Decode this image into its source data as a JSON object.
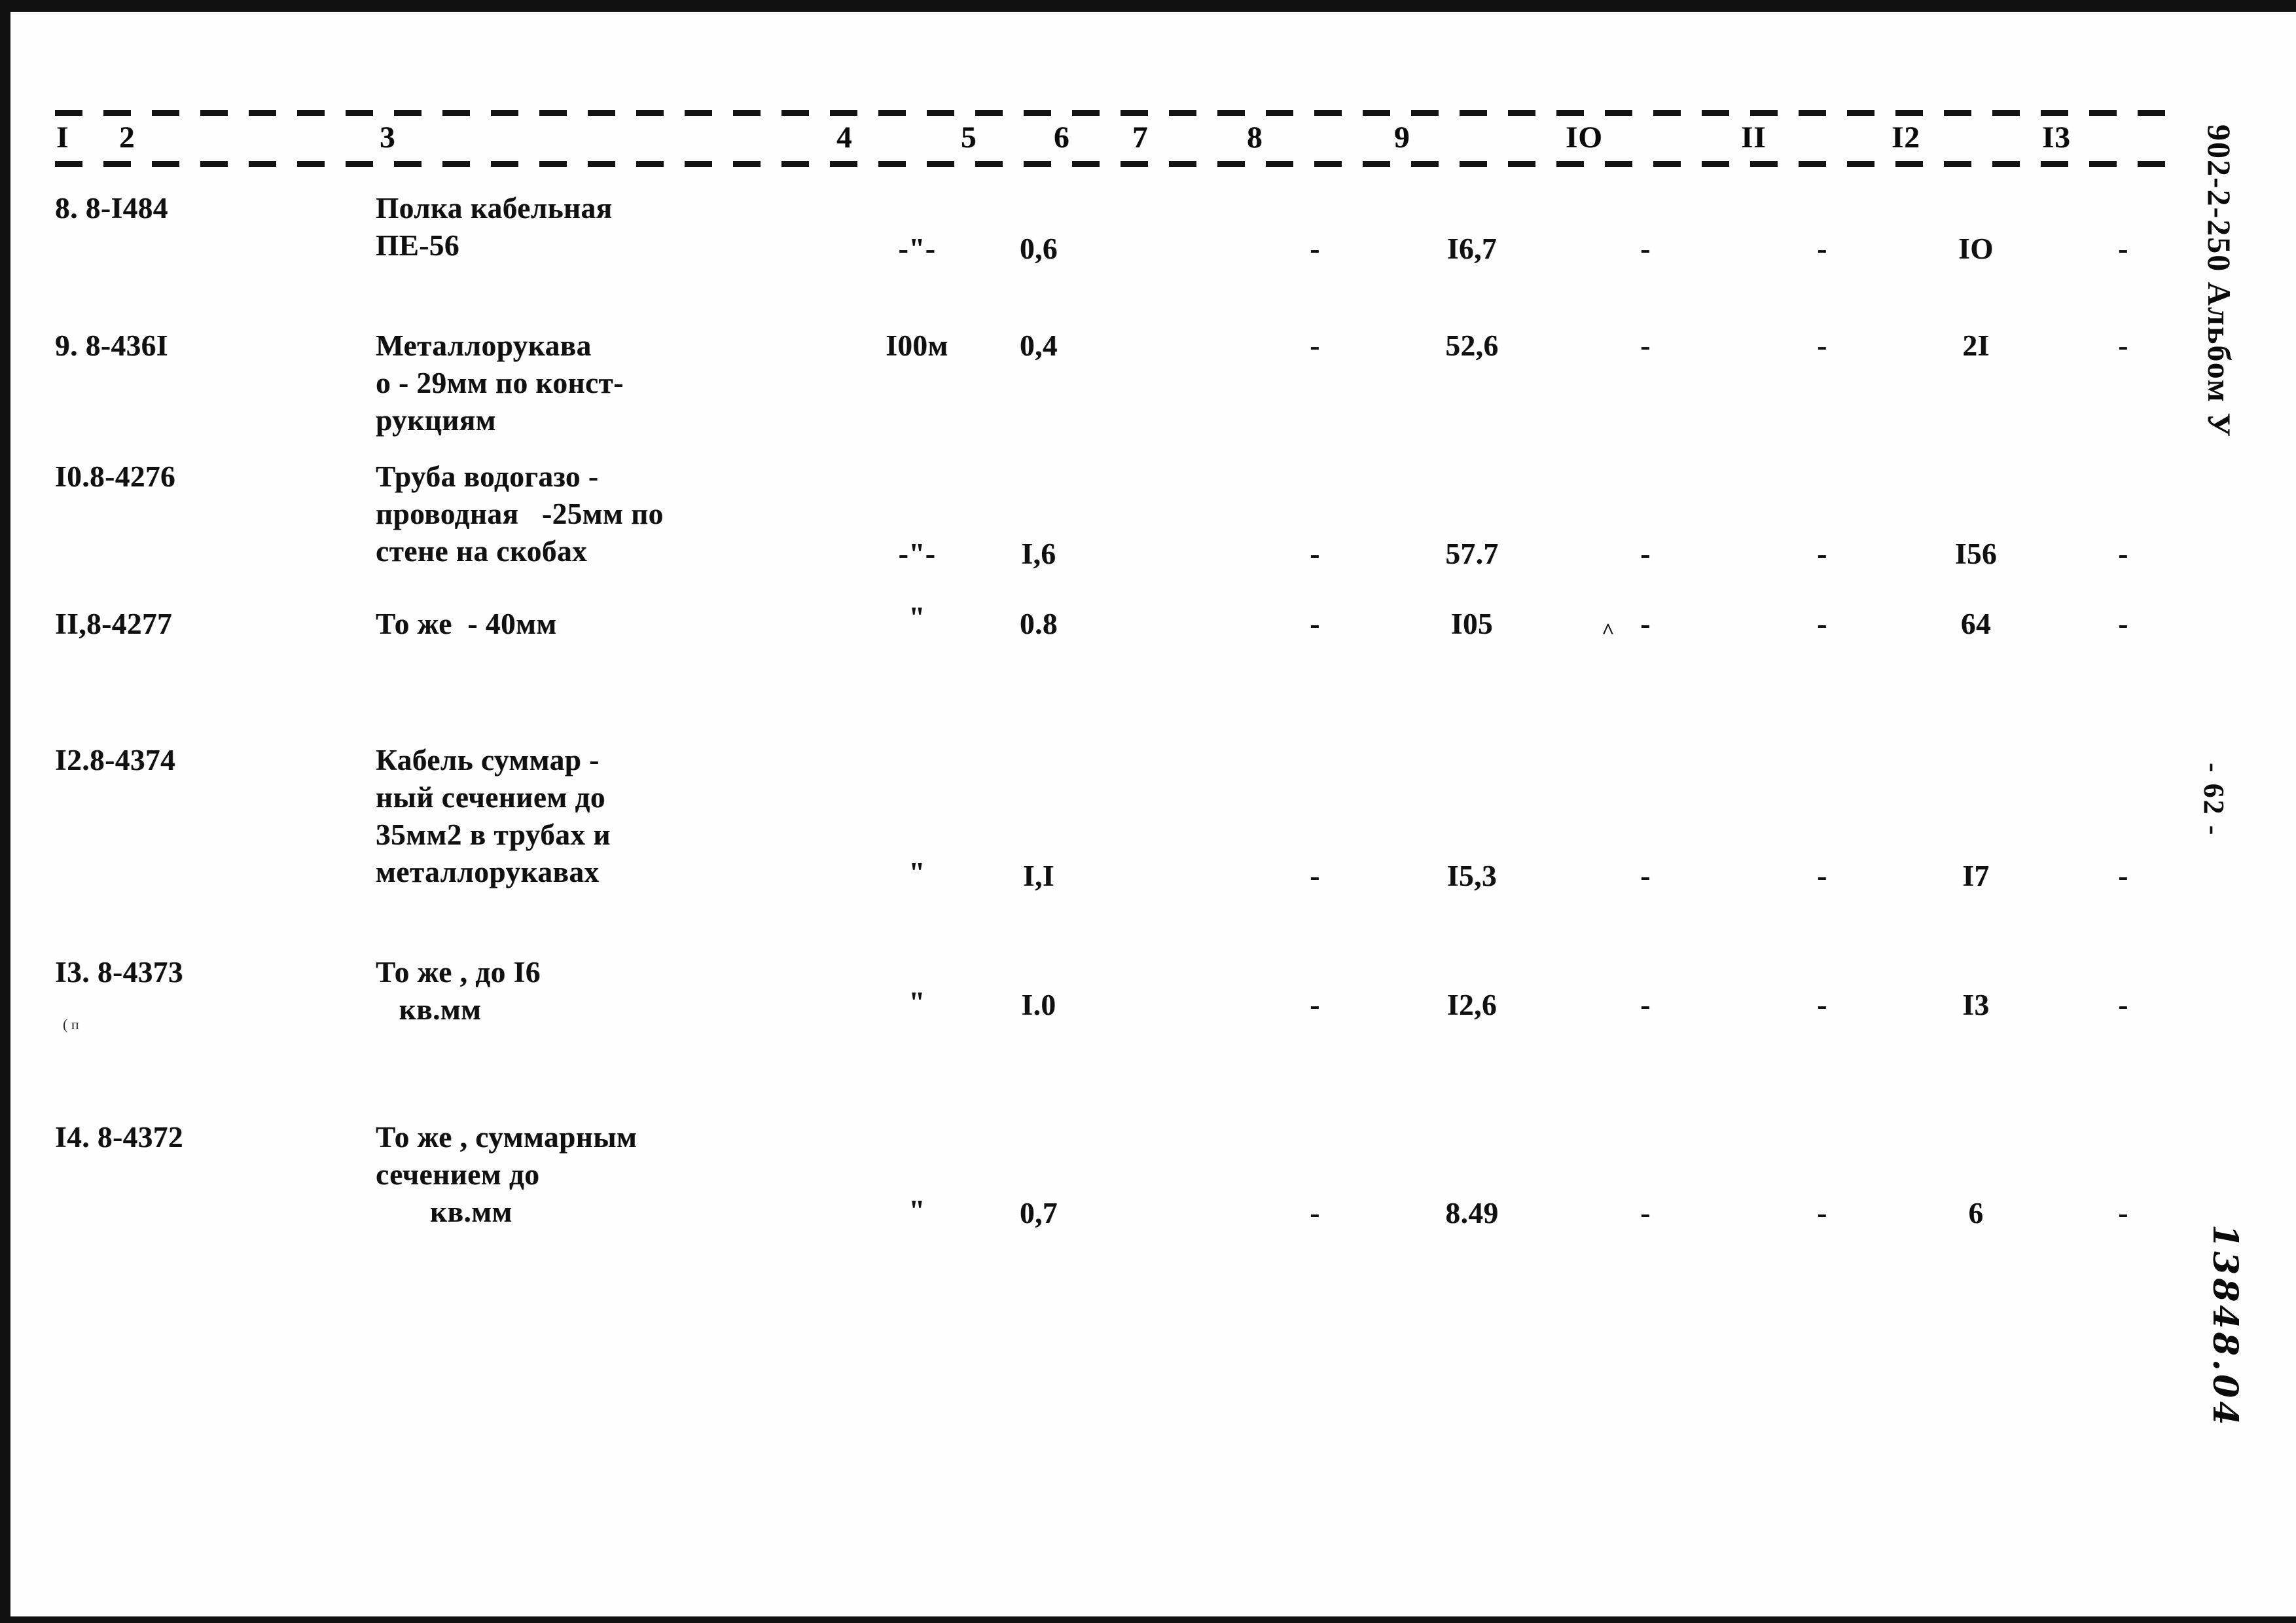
{
  "document": {
    "side_stamp": "902-2-250 Альбом У",
    "page_marker": "- 62 -",
    "handwritten_mark": "13848.04"
  },
  "table": {
    "column_headers": [
      "I",
      "2",
      "3",
      "4",
      "5",
      "6",
      "7",
      "8",
      "9",
      "IO",
      "II",
      "I2",
      "I3"
    ],
    "rows": [
      {
        "c1": "8. 8-I484",
        "c3": "Полка кабельная\nПЕ-56",
        "c4": "-\"-",
        "c5": "0,6",
        "c6": "",
        "c7": "",
        "c8": "-",
        "c9": "I6,7",
        "c10": "-",
        "c11": "-",
        "c12": "IO",
        "c13": "-"
      },
      {
        "c1": "9. 8-436I",
        "c3": "Металлорукава\nо - 29мм по конст-\nрукциям",
        "c4": "I00м",
        "c5": "0,4",
        "c6": "",
        "c7": "",
        "c8": "-",
        "c9": "52,6",
        "c10": "-",
        "c11": "-",
        "c12": "2I",
        "c13": "-"
      },
      {
        "c1": "I0.8-4276",
        "c3": "Труба водогазо -\nпроводная   -25мм по\nстене на скобах",
        "c4": "-\"-",
        "c5": "I,6",
        "c6": "",
        "c7": "",
        "c8": "-",
        "c9": "57.7",
        "c10": "-",
        "c11": "-",
        "c12": "I56",
        "c13": "-"
      },
      {
        "c1": "II,8-4277",
        "c3": "То же  - 40мм",
        "c4": "\"",
        "c5": "0.8",
        "c6": "",
        "c7": "",
        "c8": "-",
        "c9": "I05",
        "c10": "-",
        "c11": "-",
        "c12": "64",
        "c13": "-"
      },
      {
        "c1": "I2.8-4374",
        "c3": "Кабель суммар -\nный сечением до\n35мм2 в трубах и\nметаллорукавах",
        "c4": "\"",
        "c5": "I,I",
        "c6": "",
        "c7": "",
        "c8": "-",
        "c9": "I5,3",
        "c10": "-",
        "c11": "-",
        "c12": "I7",
        "c13": "-"
      },
      {
        "c1": "I3. 8-4373",
        "c3": "То же , до I6\n   кв.мм",
        "c4": "\"",
        "c5": "I.0",
        "c6": "",
        "c7": "",
        "c8": "-",
        "c9": "I2,6",
        "c10": "-",
        "c11": "-",
        "c12": "I3",
        "c13": "-"
      },
      {
        "c1": "I4. 8-4372",
        "c3": "То же , суммарным\nсечением до\n       кв.мм",
        "c4": "\"",
        "c5": "0,7",
        "c6": "",
        "c7": "",
        "c8": "-",
        "c9": "8.49",
        "c10": "-",
        "c11": "-",
        "c12": "6",
        "c13": "-"
      }
    ]
  },
  "marks": {
    "caret": "^",
    "smudge": "( п"
  }
}
